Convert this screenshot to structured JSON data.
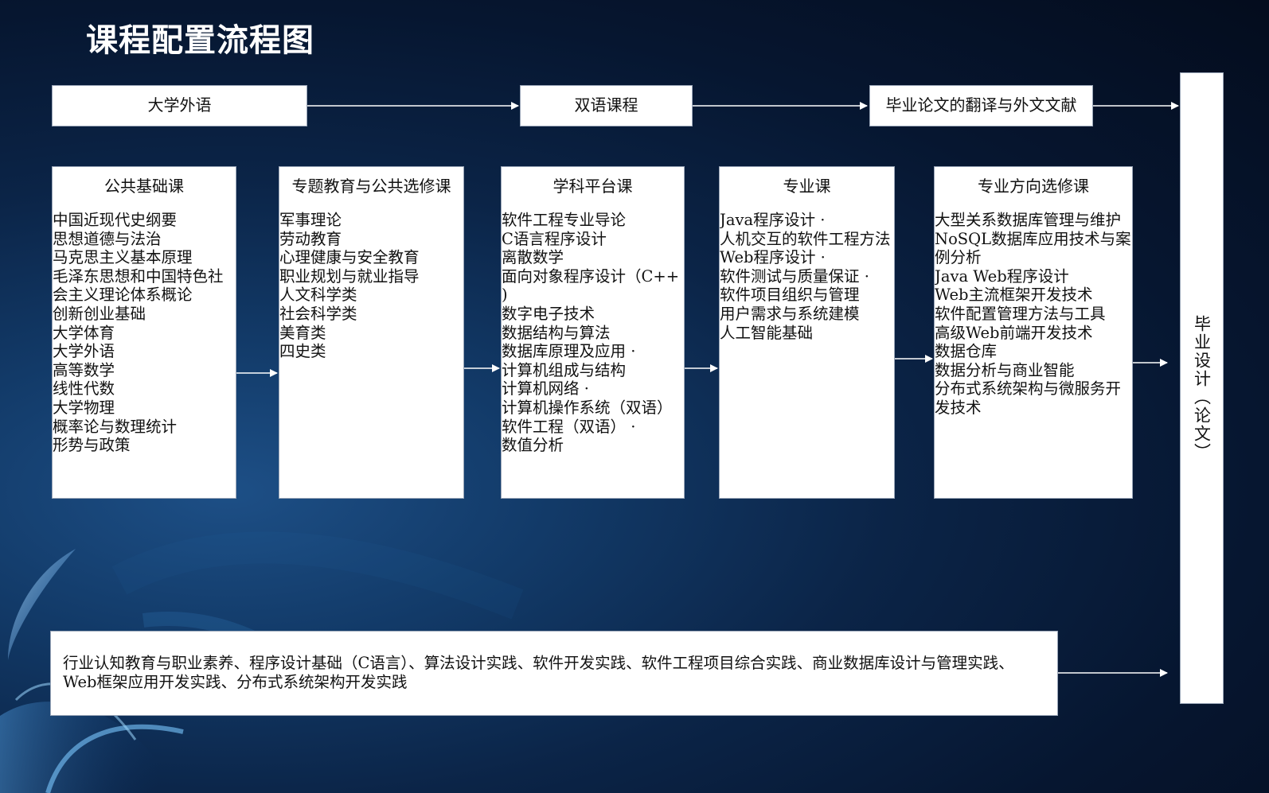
{
  "title": "课程配置流程图",
  "top_row": [
    "大学外语",
    "双语课程",
    "毕业论文的翻译与外文文献"
  ],
  "columns": [
    {
      "header": "公共基础课",
      "items": [
        "中国近现代史纲要",
        "思想道德与法治",
        "马克思主义基本原理",
        "毛泽东思想和中国特色社",
        "会主义理论体系概论",
        "创新创业基础",
        "大学体育",
        "大学外语",
        "高等数学",
        "线性代数",
        "大学物理",
        "概率论与数理统计",
        "形势与政策"
      ]
    },
    {
      "header": "专题教育与公共选修课",
      "items": [
        "军事理论",
        "劳动教育",
        "心理健康与安全教育",
        "职业规划与就业指导",
        "人文科学类",
        "社会科学类",
        "美育类",
        "四史类"
      ]
    },
    {
      "header": "学科平台课",
      "items": [
        "软件工程专业导论",
        "C语言程序设计",
        "离散数学",
        "面向对象程序设计（C++",
        ")",
        "数字电子技术",
        "数据结构与算法",
        "数据库原理及应用 ·",
        "计算机组成与结构",
        "计算机网络 ·",
        "计算机操作系统（双语）",
        "软件工程（双语） ·",
        "数值分析"
      ]
    },
    {
      "header": "专业课",
      "items": [
        "Java程序设计 ·",
        "人机交互的软件工程方法",
        "Web程序设计 ·",
        "软件测试与质量保证 ·",
        "软件项目组织与管理",
        "用户需求与系统建模",
        "人工智能基础"
      ]
    },
    {
      "header": "专业方向选修课",
      "items": [
        "大型关系数据库管理与维护",
        "NoSQL数据库应用技术与案",
        "例分析",
        "Java Web程序设计",
        "Web主流框架开发技术",
        "软件配置管理方法与工具",
        "高级Web前端开发技术",
        "数据仓库",
        "数据分析与商业智能",
        "分布式系统架构与微服务开",
        "发技术"
      ]
    }
  ],
  "practice_lines": [
    "行业认知教育与职业素养、程序设计基础（C语言）、算法设计实践、软件开发实践、软件工程项目综合实践、商业数据库设计与管理实践、",
    "Web框架应用开发实践、分布式系统架构开发实践"
  ],
  "final_box": "毕业设计（论文）"
}
